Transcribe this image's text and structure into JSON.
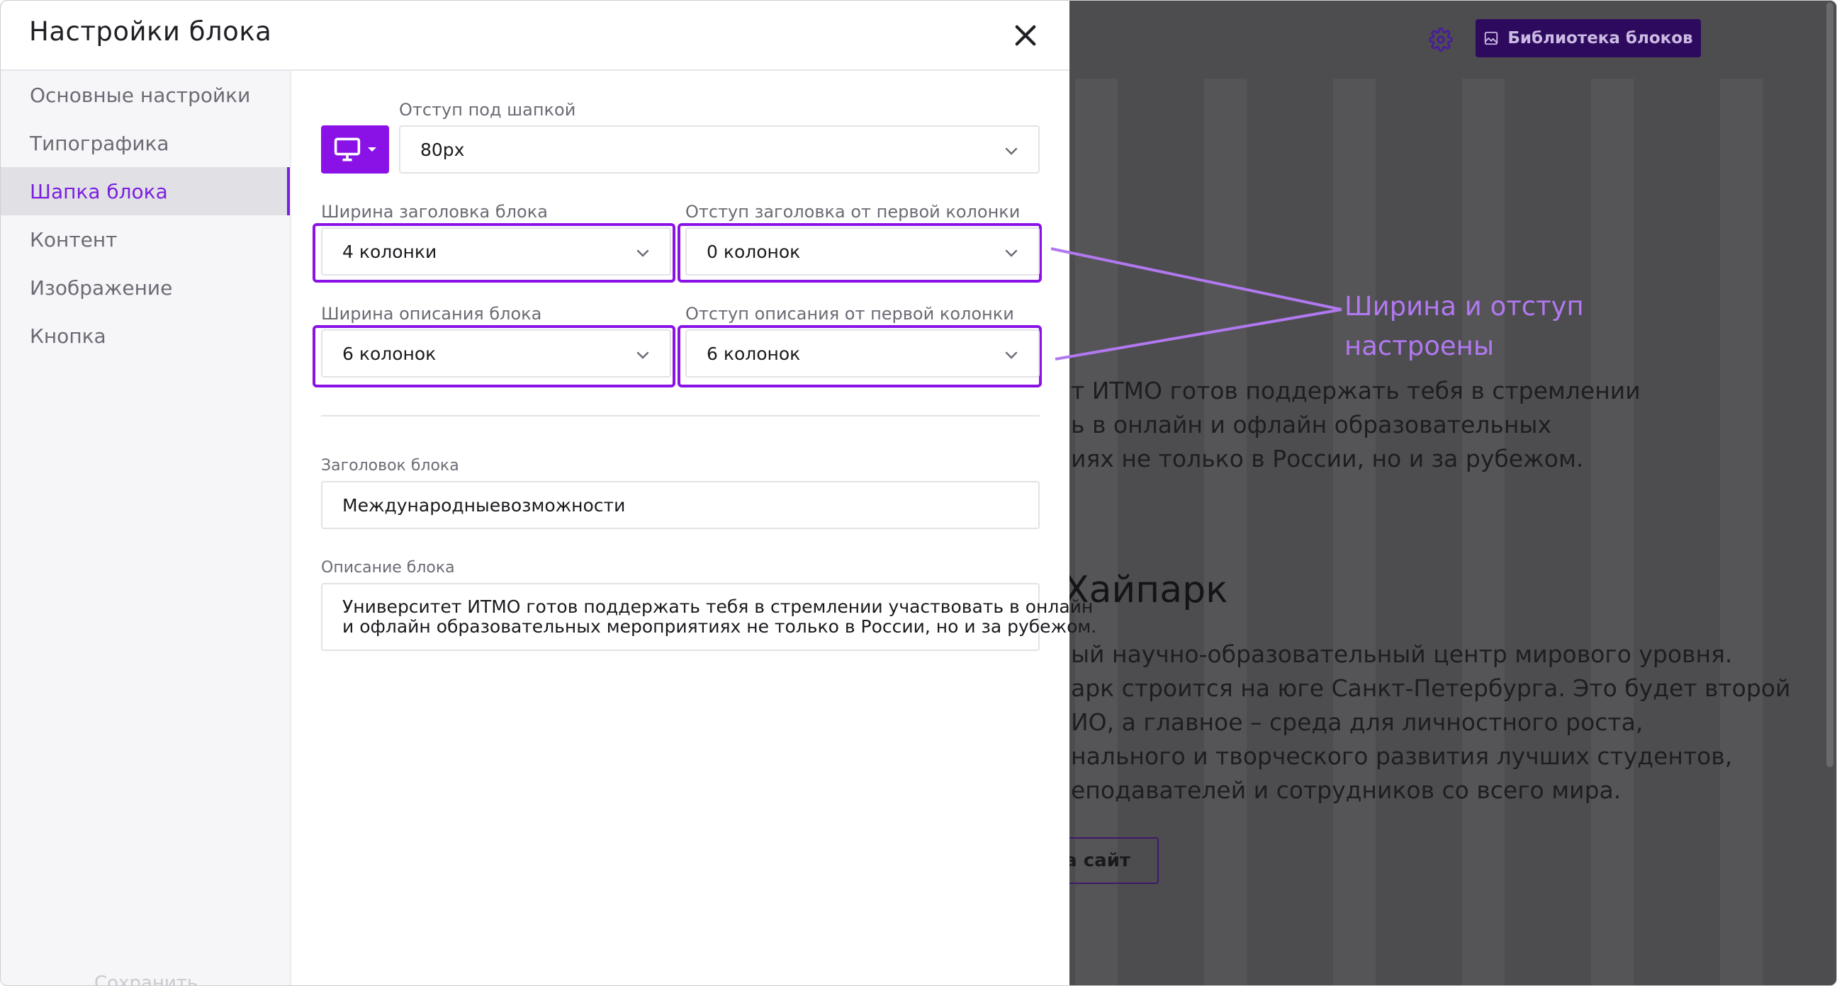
{
  "modal": {
    "title": "Настройки блока",
    "sidebar_items": [
      {
        "label": "Основные настройки",
        "active": false
      },
      {
        "label": "Типографика",
        "active": false
      },
      {
        "label": "Шапка блока",
        "active": true
      },
      {
        "label": "Контент",
        "active": false
      },
      {
        "label": "Изображение",
        "active": false
      },
      {
        "label": "Кнопка",
        "active": false
      }
    ],
    "save_label": "Сохранить",
    "header_offset": {
      "label": "Отступ под шапкой",
      "value": "80px"
    },
    "title_width": {
      "label": "Ширина заголовка блока",
      "value": "4 колонки"
    },
    "title_offset": {
      "label": "Отступ заголовка от первой колонки",
      "value": "0 колонок"
    },
    "desc_width": {
      "label": "Ширина описания блока",
      "value": "6 колонок"
    },
    "desc_offset": {
      "label": "Отступ описания от первой колонки",
      "value": "6 колонок"
    },
    "block_title": {
      "label": "Заголовок блока",
      "value": "Международныевозможности"
    },
    "block_desc": {
      "label": "Описание блока",
      "line1": "Университет ИТМО готов поддержать тебя в стремлении участвовать в онлайн",
      "line2": "и офлайн образовательных мероприятиях не только в России, но и за рубежом."
    }
  },
  "annotation": {
    "line1": "Ширина и отступ",
    "line2": "настроены",
    "color": "#b178f0"
  },
  "background_page": {
    "library_button": "Библиотека блоков",
    "desc_lines": [
      "т ИТМО готов поддержать тебя в стремлении",
      "ь в онлайн и офлайн образовательных",
      "иях не только в России, но и за рубежом."
    ],
    "heading": "Хайпарк",
    "body_lines": [
      "ый научно-образовательный центр мирового уровня.",
      "арк строится на юге Санкт-Петербурга. Это будет второй",
      "ИО, а главное – среда для личностного роста,",
      "нального и творческого развития лучших студентов,",
      "еподавателей и сотрудников со всего мира."
    ],
    "link_button": "а сайт"
  },
  "colors": {
    "accent": "#8a12e6",
    "active_text": "#7a1fe0"
  }
}
